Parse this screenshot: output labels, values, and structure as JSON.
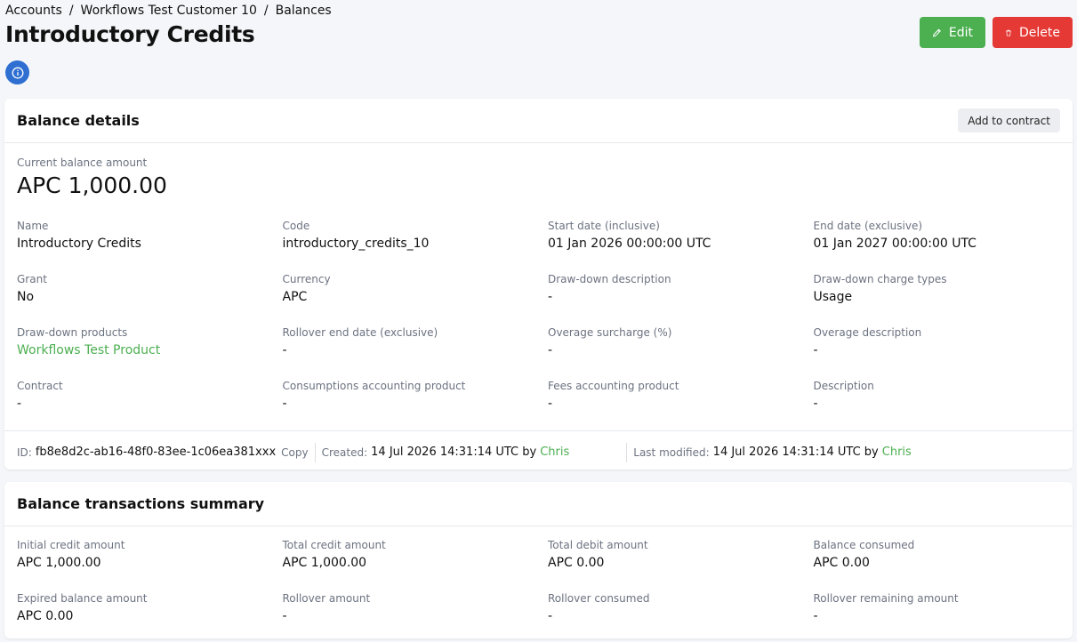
{
  "breadcrumb": [
    "Accounts",
    "Workflows Test Customer 10",
    "Balances"
  ],
  "page_title": "Introductory Credits",
  "actions": {
    "edit": "Edit",
    "delete": "Delete"
  },
  "balance_details": {
    "title": "Balance details",
    "add_to_contract": "Add to contract",
    "current_label": "Current balance amount",
    "current_value": "APC 1,000.00",
    "fields": [
      {
        "label": "Name",
        "value": "Introductory Credits"
      },
      {
        "label": "Code",
        "value": "introductory_credits_10"
      },
      {
        "label": "Start date (inclusive)",
        "value": "01 Jan 2026 00:00:00 UTC"
      },
      {
        "label": "End date (exclusive)",
        "value": "01 Jan 2027 00:00:00 UTC"
      },
      {
        "label": "Grant",
        "value": "No"
      },
      {
        "label": "Currency",
        "value": "APC"
      },
      {
        "label": "Draw-down description",
        "value": "-"
      },
      {
        "label": "Draw-down charge types",
        "value": "Usage"
      },
      {
        "label": "Draw-down products",
        "value": "Workflows Test Product"
      },
      {
        "label": "Rollover end date (exclusive)",
        "value": "-"
      },
      {
        "label": "Overage surcharge (%)",
        "value": "-"
      },
      {
        "label": "Overage description",
        "value": "-"
      },
      {
        "label": "Contract",
        "value": "-"
      },
      {
        "label": "Consumptions accounting product",
        "value": "-"
      },
      {
        "label": "Fees accounting product",
        "value": "-"
      },
      {
        "label": "Description",
        "value": "-"
      }
    ],
    "meta": {
      "id_label": "ID:",
      "id_value": "fb8e8d2c-ab16-48f0-83ee-1c06ea381xxx",
      "copy": "Copy",
      "created_label": "Created:",
      "created_value": "14 Jul 2026 14:31:14 UTC by",
      "created_by": "Chris",
      "modified_label": "Last modified:",
      "modified_value": "14 Jul 2026 14:31:14 UTC by",
      "modified_by": "Chris"
    }
  },
  "transactions": {
    "title": "Balance transactions summary",
    "fields": [
      {
        "label": "Initial credit amount",
        "value": "APC 1,000.00"
      },
      {
        "label": "Total credit amount",
        "value": "APC 1,000.00"
      },
      {
        "label": "Total debit amount",
        "value": "APC 0.00"
      },
      {
        "label": "Balance consumed",
        "value": "APC 0.00"
      },
      {
        "label": "Expired balance amount",
        "value": "APC 0.00"
      },
      {
        "label": "Rollover amount",
        "value": "-"
      },
      {
        "label": "Rollover consumed",
        "value": "-"
      },
      {
        "label": "Rollover remaining amount",
        "value": "-"
      }
    ]
  },
  "colors": {
    "accent": "#4caf50",
    "danger": "#e53935",
    "info": "#2e6fd1"
  }
}
